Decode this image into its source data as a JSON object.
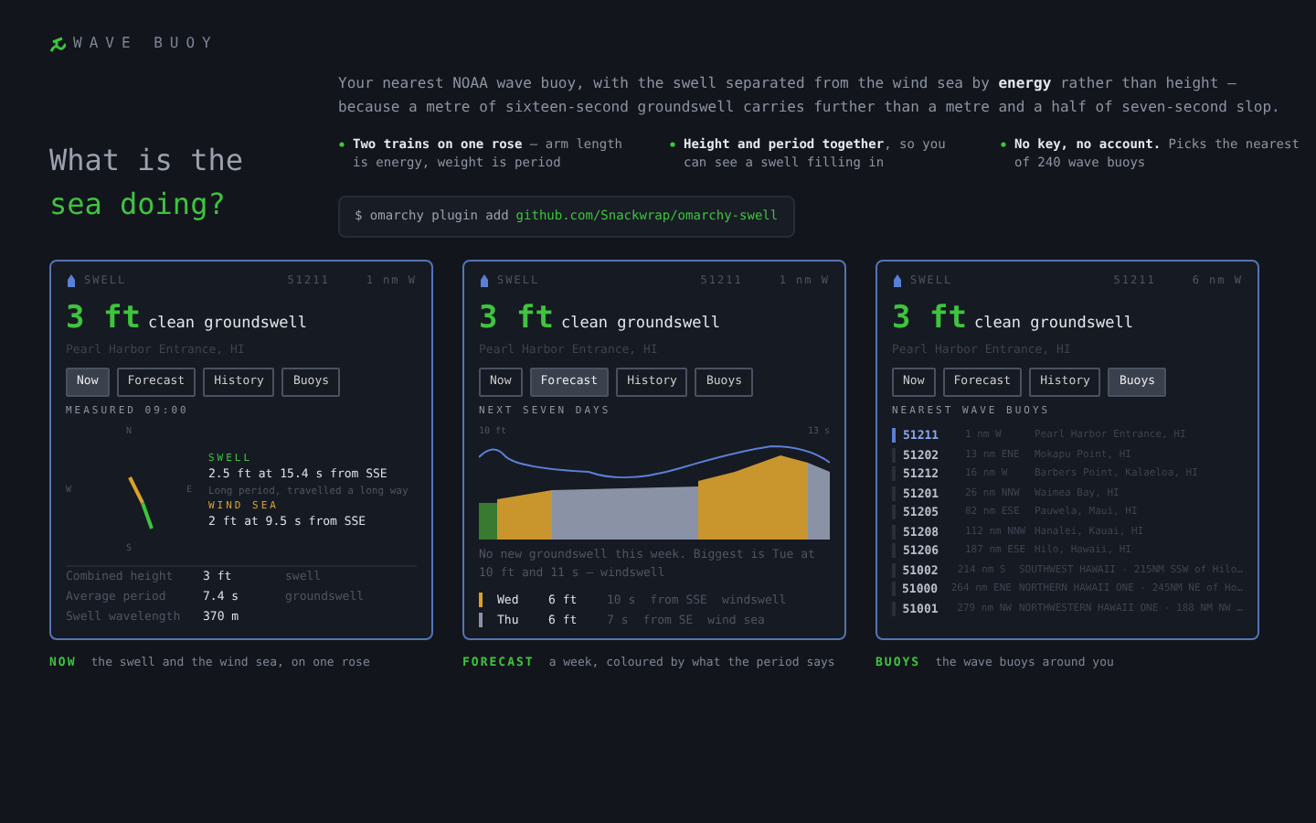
{
  "brand": {
    "name": "WAVE BUOY"
  },
  "headline": {
    "line_1": "What is the",
    "line_2": "sea doing?"
  },
  "intro": "Your nearest NOAA wave buoy, with the swell separated from the wind sea by **energy** rather than height — because a metre of sixteen-second groundswell carries further than a metre and a half of seven-second slop.",
  "features": [
    {
      "title": "Two trains on one rose",
      "text": " — arm length is energy, weight is period"
    },
    {
      "title": "Height and period together",
      "text": ", so you can see a swell filling in"
    },
    {
      "title": "No key, no account.",
      "text": " Picks the nearest of 240 wave buoys"
    }
  ],
  "command": {
    "prompt": "$ omarchy plugin add",
    "link": "github.com/Snackwrap/omarchy-swell"
  },
  "cards": [
    {
      "kind": "now",
      "app": "SWELL",
      "station": "51211",
      "distance": "1 nm W",
      "height": "3 ft",
      "summary": "clean groundswell",
      "location": "Pearl Harbor Entrance, HI",
      "tabs": [
        {
          "label": "Now",
          "selected": true
        },
        {
          "label": "Forecast",
          "selected": false
        },
        {
          "label": "History",
          "selected": false
        },
        {
          "label": "Buoys",
          "selected": false
        }
      ],
      "section": "MEASURED 09:00",
      "compass": [
        "N",
        "W",
        "E",
        "S"
      ],
      "trains": [
        {
          "label": "SWELL",
          "values": "2.5 ft  at 15.4 s  from SSE",
          "note": "Long period, travelled a long way",
          "color": "#3ec43e"
        },
        {
          "label": "WIND SEA",
          "values": "2 ft  at 9.5 s  from SSE",
          "color": "#d9a22a"
        }
      ],
      "rows": [
        [
          "Combined height",
          "3 ft",
          "swell"
        ],
        [
          "Average period",
          "7.4 s",
          "groundswell"
        ],
        [
          "Swell wavelength",
          "370 m",
          ""
        ]
      ],
      "caption": {
        "tag": "NOW",
        "text": "the swell and the wind sea, on one rose"
      }
    },
    {
      "kind": "forecast",
      "app": "SWELL",
      "station": "51211",
      "distance": "1 nm W",
      "height": "3 ft",
      "summary": "clean groundswell",
      "location": "Pearl Harbor Entrance, HI",
      "tabs": [
        {
          "label": "Now",
          "selected": false
        },
        {
          "label": "Forecast",
          "selected": true
        },
        {
          "label": "History",
          "selected": false
        },
        {
          "label": "Buoys",
          "selected": false
        }
      ],
      "section": "NEXT SEVEN DAYS",
      "chart_left": "10 ft",
      "chart_right": "13 s",
      "note": "No new groundswell this week. Biggest is Tue at 10 ft and 11 s — windswell",
      "days": [
        {
          "day": "Wed",
          "height": "6 ft",
          "period": "10 s",
          "from": "from SSE",
          "type": "windswell",
          "color": "#d9a22a"
        },
        {
          "day": "Thu",
          "height": "6 ft",
          "period": "7 s",
          "from": "from SE",
          "type": "wind sea",
          "color": "#8a93a6"
        }
      ],
      "caption": {
        "tag": "FORECAST",
        "text": "a week, coloured by what the period says"
      }
    },
    {
      "kind": "buoys",
      "app": "SWELL",
      "station": "51211",
      "distance": "6 nm W",
      "height": "3 ft",
      "summary": "clean groundswell",
      "location": "Pearl Harbor Entrance, HI",
      "tabs": [
        {
          "label": "Now",
          "selected": false
        },
        {
          "label": "Forecast",
          "selected": false
        },
        {
          "label": "History",
          "selected": false
        },
        {
          "label": "Buoys",
          "selected": true
        }
      ],
      "section": "NEAREST WAVE BUOYS",
      "buoys": [
        {
          "id": "51211",
          "dist": "1 nm W",
          "name": "Pearl Harbor Entrance, HI",
          "selected": true
        },
        {
          "id": "51202",
          "dist": "13 nm ENE",
          "name": "Mokapu Point, HI",
          "selected": false
        },
        {
          "id": "51212",
          "dist": "16 nm W",
          "name": "Barbers Point, Kalaeloa, HI",
          "selected": false
        },
        {
          "id": "51201",
          "dist": "26 nm NNW",
          "name": "Waimea Bay, HI",
          "selected": false
        },
        {
          "id": "51205",
          "dist": "82 nm ESE",
          "name": "Pauwela, Maui, HI",
          "selected": false
        },
        {
          "id": "51208",
          "dist": "112 nm NNW",
          "name": "Hanalei, Kauai, HI",
          "selected": false
        },
        {
          "id": "51206",
          "dist": "187 nm ESE",
          "name": "Hilo, Hawaii, HI",
          "selected": false
        },
        {
          "id": "51002",
          "dist": "214 nm S",
          "name": "SOUTHWEST HAWAII - 215NM SSW of Hilo…",
          "selected": false
        },
        {
          "id": "51000",
          "dist": "264 nm ENE",
          "name": "NORTHERN HAWAII ONE - 245NM NE of Ho…",
          "selected": false
        },
        {
          "id": "51001",
          "dist": "279 nm NW",
          "name": "NORTHWESTERN HAWAII ONE - 188 NM NW …",
          "selected": false
        }
      ],
      "caption": {
        "tag": "BUOYS",
        "text": "the wave buoys around you"
      }
    }
  ]
}
